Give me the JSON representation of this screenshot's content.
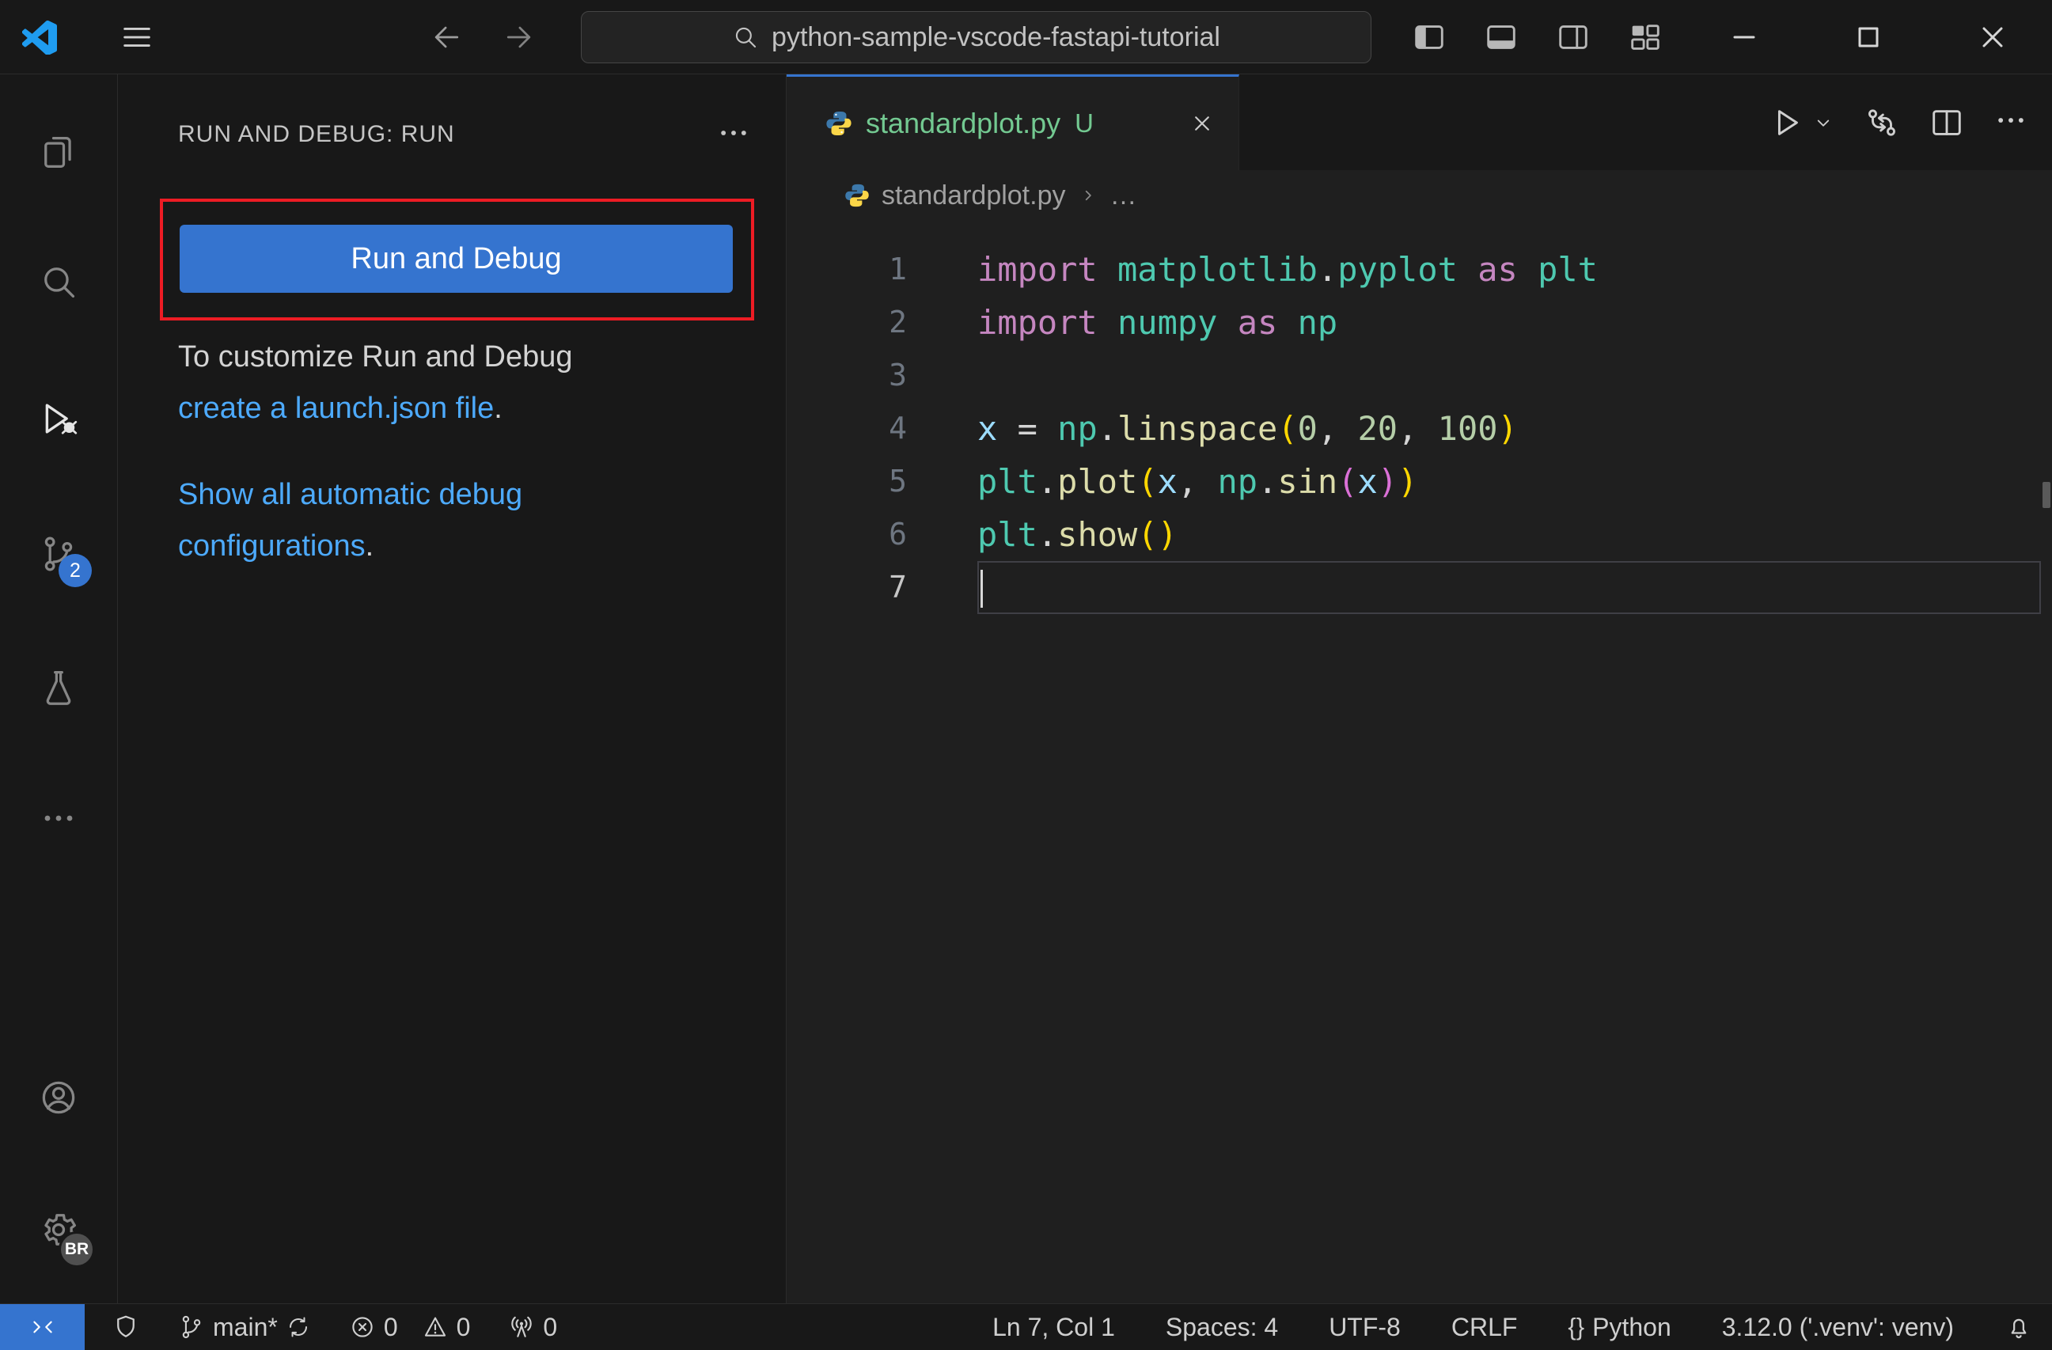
{
  "colors": {
    "accent": "#3574cf",
    "annotation": "#ed1c24",
    "link": "#4daafc",
    "untracked": "#73C991"
  },
  "title_bar": {
    "search_value": "python-sample-vscode-fastapi-tutorial"
  },
  "activity_bar": {
    "source_control_badge": "2",
    "profile_badge": "BR"
  },
  "sidebar": {
    "title": "RUN AND DEBUG: RUN",
    "run_button_label": "Run and Debug",
    "customize_line": "To customize Run and Debug",
    "launch_link_text": "create a launch.json file",
    "launch_link_suffix": ".",
    "show_all_link_line1": "Show all automatic debug",
    "show_all_link_line2": "configurations",
    "show_all_suffix": "."
  },
  "editor": {
    "tab_label": "standardplot.py",
    "tab_git_status": "U",
    "breadcrumb_file": "standardplot.py",
    "breadcrumb_more": "…",
    "lines": [
      {
        "num": "1",
        "tokens": [
          [
            "kw",
            "import"
          ],
          [
            "pl",
            " "
          ],
          [
            "mod",
            "matplotlib"
          ],
          [
            "pl",
            "."
          ],
          [
            "mod",
            "pyplot"
          ],
          [
            "pl",
            " "
          ],
          [
            "kw",
            "as"
          ],
          [
            "pl",
            " "
          ],
          [
            "mod",
            "plt"
          ]
        ]
      },
      {
        "num": "2",
        "tokens": [
          [
            "kw",
            "import"
          ],
          [
            "pl",
            " "
          ],
          [
            "mod",
            "numpy"
          ],
          [
            "pl",
            " "
          ],
          [
            "kw",
            "as"
          ],
          [
            "pl",
            " "
          ],
          [
            "mod",
            "np"
          ]
        ]
      },
      {
        "num": "3",
        "tokens": []
      },
      {
        "num": "4",
        "tokens": [
          [
            "var",
            "x"
          ],
          [
            "pl",
            " = "
          ],
          [
            "mod",
            "np"
          ],
          [
            "pl",
            "."
          ],
          [
            "fn",
            "linspace"
          ],
          [
            "b1",
            "("
          ],
          [
            "num",
            "0"
          ],
          [
            "pl",
            ", "
          ],
          [
            "num",
            "20"
          ],
          [
            "pl",
            ", "
          ],
          [
            "num",
            "100"
          ],
          [
            "b1",
            ")"
          ]
        ]
      },
      {
        "num": "5",
        "tokens": [
          [
            "mod",
            "plt"
          ],
          [
            "pl",
            "."
          ],
          [
            "fn",
            "plot"
          ],
          [
            "b1",
            "("
          ],
          [
            "var",
            "x"
          ],
          [
            "pl",
            ", "
          ],
          [
            "mod",
            "np"
          ],
          [
            "pl",
            "."
          ],
          [
            "fn",
            "sin"
          ],
          [
            "b2",
            "("
          ],
          [
            "var",
            "x"
          ],
          [
            "b2",
            ")"
          ],
          [
            "b1",
            ")"
          ]
        ]
      },
      {
        "num": "6",
        "tokens": [
          [
            "mod",
            "plt"
          ],
          [
            "pl",
            "."
          ],
          [
            "fn",
            "show"
          ],
          [
            "b1",
            "("
          ],
          [
            "b1",
            ")"
          ]
        ]
      },
      {
        "num": "7",
        "tokens": [],
        "current": true
      }
    ]
  },
  "status_bar": {
    "branch": "main*",
    "errors": "0",
    "warnings": "0",
    "ports": "0",
    "line_col": "Ln 7, Col 1",
    "indentation": "Spaces: 4",
    "encoding": "UTF-8",
    "eol": "CRLF",
    "language_icon": "{}",
    "language": "Python",
    "interpreter": "3.12.0 ('.venv': venv)"
  },
  "icons": {
    "vscode-logo": "angular blue bracket logo",
    "menu-icon": "hamburger ☰",
    "back-arrow-icon": "←",
    "forward-arrow-icon": "→",
    "search-icon": "magnifier",
    "layout-sidebar-left-icon": "square, left pane filled",
    "layout-panel-icon": "square, bottom pane filled",
    "layout-sidebar-right-icon": "square, right pane outline",
    "customize-layout-icon": "grid of panes",
    "minimize-icon": "–",
    "maximize-icon": "□",
    "close-icon": "✕",
    "files-icon": "two pages",
    "run-debug-icon": "play triangle with bug",
    "source-control-icon": "branch graph",
    "testing-icon": "beaker flask",
    "ellipsis-icon": "…",
    "account-icon": "person in circle",
    "gear-icon": "settings cog",
    "python-icon": "blue/yellow python logo",
    "play-icon": "▷",
    "chevron-down-icon": "⌄",
    "open-changes-icon": "two circles with arrows",
    "split-editor-icon": "square split vertically",
    "remote-icon": "><",
    "shield-icon": "workspace trust shield",
    "git-branch-icon": "branch",
    "sync-icon": "circular arrows",
    "error-icon": "circle with x",
    "warning-icon": "triangle !",
    "ports-icon": "radio tower",
    "bell-icon": "notification bell"
  }
}
